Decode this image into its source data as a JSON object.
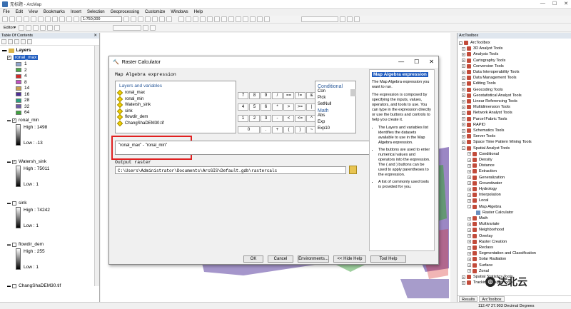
{
  "window": {
    "title": "无标题 - ArcMap"
  },
  "menu": [
    "File",
    "Edit",
    "View",
    "Bookmarks",
    "Insert",
    "Selection",
    "Geoprocessing",
    "Customize",
    "Windows",
    "Help"
  ],
  "toolbar": {
    "scale": "1:750,000",
    "editor": "Editor▾"
  },
  "toc": {
    "title": "Table Of Contents",
    "root": "Layers",
    "ronal_max": {
      "name": "ronal_max",
      "classes": [
        "1",
        "2",
        "4",
        "8",
        "14",
        "16",
        "28",
        "32",
        "64"
      ],
      "colors": [
        "#8fa6cf",
        "#4aa84a",
        "#d62a2a",
        "#c04fc0",
        "#c8a050",
        "#4d2d99",
        "#2a9f7f",
        "#6e5aa8",
        "#3fa23f"
      ]
    },
    "layers": [
      {
        "name": "ronal_min",
        "high": "High : 1498",
        "low": "Low : -13"
      },
      {
        "name": "Watersh_sink",
        "high": "High : 75011",
        "low": "Low : 1"
      },
      {
        "name": "sink",
        "high": "High : 74242",
        "low": "Low : 1"
      },
      {
        "name": "flowdir_dem",
        "high": "High : 255",
        "low": "Low : 1"
      },
      {
        "name": "ChangShaDEM30.tif",
        "high": "",
        "low": ""
      }
    ]
  },
  "dialog": {
    "title": "Raster Calculator",
    "map_algebra_label": "Map Algebra expression",
    "layers_title": "Layers and variables",
    "layers": [
      "ronal_max",
      "ronal_min",
      "Watersh_sink",
      "sink",
      "flowdir_dem",
      "ChangShaDEM30.tif"
    ],
    "keys": [
      "7",
      "8",
      "9",
      "/",
      "==",
      "!=",
      "&",
      "4",
      "5",
      "6",
      "*",
      ">",
      ">=",
      "|",
      "1",
      "2",
      "3",
      "-",
      "<",
      "<=",
      "^",
      "0",
      ".",
      "+",
      "(",
      ")",
      "~"
    ],
    "conditional_title": "Conditional",
    "conditional": [
      "Con",
      "Pick",
      "SetNull"
    ],
    "math_title": "Math",
    "math": [
      "Abs",
      "Exp",
      "Exp10"
    ],
    "expression": "\"ronal_max\" - \"ronal_min\"",
    "output_label": "Output raster",
    "output_path": "C:\\Users\\Administrator\\Documents\\ArcGIS\\Default.gdb\\rastercalc",
    "buttons": {
      "ok": "OK",
      "cancel": "Cancel",
      "env": "Environments...",
      "hide": "<< Hide Help",
      "tool_help": "Tool Help"
    },
    "help": {
      "title": "Map Algebra expression",
      "p1": "The Map Algebra expression you want to run.",
      "p2": "The expression is composed by specifying the inputs, values, operators, and tools to use. You can type in the expression directly or use the buttons and controls to help you create it.",
      "b1": "The Layers and variables list identifies the datasets available to use in the Map Algebra expression.",
      "b2": "The buttons are used to enter numerical values and operators into the expression. The ( and ) buttons can be used to apply parentheses to the expression.",
      "b3": "A list of commonly used tools is provided for you."
    }
  },
  "arctoolbox": {
    "title": "ArcToolbox",
    "root": "ArcToolbox",
    "toolboxes": [
      "3D Analyst Tools",
      "Analysis Tools",
      "Cartography Tools",
      "Conversion Tools",
      "Data Interoperability Tools",
      "Data Management Tools",
      "Editing Tools",
      "Geocoding Tools",
      "Geostatistical Analyst Tools",
      "Linear Referencing Tools",
      "Multidimension Tools",
      "Network Analyst Tools",
      "Parcel Fabric Tools",
      "RAPID",
      "Schematics Tools",
      "Server Tools",
      "Space Time Pattern Mining Tools",
      "Spatial Analyst Tools"
    ],
    "spatial_children": [
      "Conditional",
      "Density",
      "Distance",
      "Extraction",
      "Generalization",
      "Groundwater",
      "Hydrology",
      "Interpolation",
      "Local",
      "Map Algebra"
    ],
    "map_algebra_tool": "Raster Calculator",
    "after": [
      "Math",
      "Multivariate",
      "Neighborhood",
      "Overlay",
      "Raster Creation",
      "Reclass",
      "Segmentation and Classification",
      "Solar Radiation",
      "Surface",
      "Zonal"
    ],
    "tail": [
      "Spatial Statistics Tools",
      "Tracking Analyst Tools"
    ],
    "tabs": [
      "Results",
      "ArcToolbox"
    ]
  },
  "side_tabs": [
    "Create Features",
    "Catalog",
    "Search"
  ],
  "status": {
    "coords": "112.47  27.903 Decimal Degrees"
  },
  "watermark": {
    "text": "达北云"
  }
}
